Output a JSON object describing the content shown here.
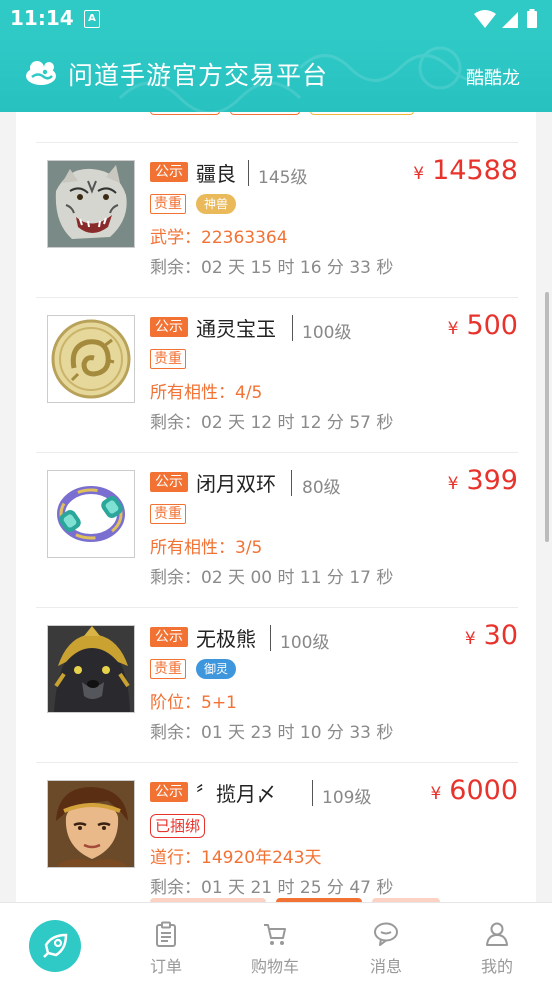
{
  "status_bar": {
    "time": "11:14",
    "notification": "A"
  },
  "header": {
    "title": "问道手游官方交易平台",
    "user": "酷酷龙"
  },
  "labels": {
    "public": "公示",
    "rare": "贵重",
    "yen": "¥"
  },
  "items": [
    {
      "name": "疆良",
      "level": "145级",
      "price": "14588",
      "pill": "神兽",
      "pill_color": "#e9b95a",
      "attr": "武学：22363364",
      "remain": "剩余：02 天 15 时 16 分 33 秒",
      "thumb_icon": "white-tiger-beast-icon"
    },
    {
      "name": "通灵宝玉",
      "level": "100级",
      "price": "500",
      "attr": "所有相性：4/5",
      "remain": "剩余：02 天 12 时 12 分 57 秒",
      "thumb_icon": "jade-pendant-icon"
    },
    {
      "name": "闭月双环",
      "level": "80级",
      "price": "399",
      "attr": "所有相性：3/5",
      "remain": "剩余：02 天 00 时 11 分 17 秒",
      "thumb_icon": "double-ring-icon"
    },
    {
      "name": "无极熊",
      "level": "100级",
      "price": "30",
      "pill": "御灵",
      "pill_color": "#3e97dd",
      "attr": "阶位：5+1",
      "remain": "剩余：01 天 23 时 10 分 33 秒",
      "thumb_icon": "armored-bear-icon"
    },
    {
      "name": "〞揽月〆",
      "level": "109级",
      "price": "6000",
      "bound": "已捆绑",
      "attr": "道行：14920年243天",
      "remain": "剩余：01 天 21 时 25 分 47 秒",
      "thumb_icon": "character-portrait-icon"
    }
  ],
  "nav": [
    {
      "label": "订单",
      "icon": "clipboard-icon"
    },
    {
      "label": "购物车",
      "icon": "cart-icon"
    },
    {
      "label": "消息",
      "icon": "chat-bubble-icon"
    },
    {
      "label": "我的",
      "icon": "user-icon"
    }
  ],
  "colors": {
    "primary": "#2fc9c6",
    "accent": "#f27234",
    "price": "#e8332c"
  }
}
